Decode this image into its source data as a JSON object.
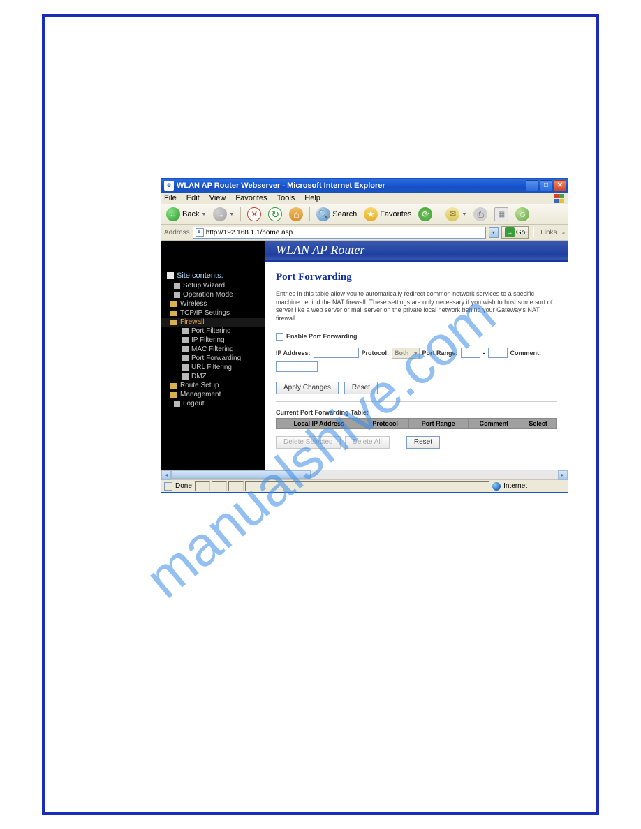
{
  "titlebar": {
    "title": "WLAN AP Router Webserver - Microsoft Internet Explorer"
  },
  "menubar": {
    "items": [
      "File",
      "Edit",
      "View",
      "Favorites",
      "Tools",
      "Help"
    ]
  },
  "toolbar": {
    "back": "Back",
    "search": "Search",
    "favorites": "Favorites"
  },
  "address": {
    "label": "Address",
    "url": "http://192.168.1.1/home.asp",
    "go": "Go",
    "links": "Links"
  },
  "sidebar": {
    "heading": "Site contents:",
    "items": [
      {
        "label": "Setup Wizard",
        "type": "page"
      },
      {
        "label": "Operation Mode",
        "type": "page"
      },
      {
        "label": "Wireless",
        "type": "folder"
      },
      {
        "label": "TCP/IP Settings",
        "type": "folder"
      },
      {
        "label": "Firewall",
        "type": "folder",
        "active": true
      },
      {
        "label": "Port Filtering",
        "type": "sub"
      },
      {
        "label": "IP Filtering",
        "type": "sub"
      },
      {
        "label": "MAC Filtering",
        "type": "sub"
      },
      {
        "label": "Port Forwarding",
        "type": "sub"
      },
      {
        "label": "URL Filtering",
        "type": "sub"
      },
      {
        "label": "DMZ",
        "type": "sub"
      },
      {
        "label": "Route Setup",
        "type": "folder"
      },
      {
        "label": "Management",
        "type": "folder"
      },
      {
        "label": "Logout",
        "type": "page"
      }
    ]
  },
  "main": {
    "banner": "WLAN AP Router",
    "title": "Port Forwarding",
    "description": "Entries in this table allow you to automatically redirect common network services to a specific machine behind the NAT firewall. These settings are only necessary if you wish to host some sort of server like a web server or mail server on the private local network behind your Gateway's NAT firewall.",
    "enable_label": "Enable Port Forwarding",
    "ip_label": "IP Address:",
    "protocol_label": "Protocol:",
    "protocol_value": "Both",
    "port_range_label": "Port Range:",
    "port_range_sep": "-",
    "comment_label": "Comment:",
    "apply_btn": "Apply Changes",
    "reset1_btn": "Reset",
    "table_label": "Current Port Forwarding Table:",
    "headers": [
      "Local IP Address",
      "Protocol",
      "Port Range",
      "Comment",
      "Select"
    ],
    "delete_sel_btn": "Delete Selected",
    "delete_all_btn": "Delete All",
    "reset2_btn": "Reset"
  },
  "statusbar": {
    "status": "Done",
    "zone": "Internet"
  },
  "watermark": "manualshive.com"
}
